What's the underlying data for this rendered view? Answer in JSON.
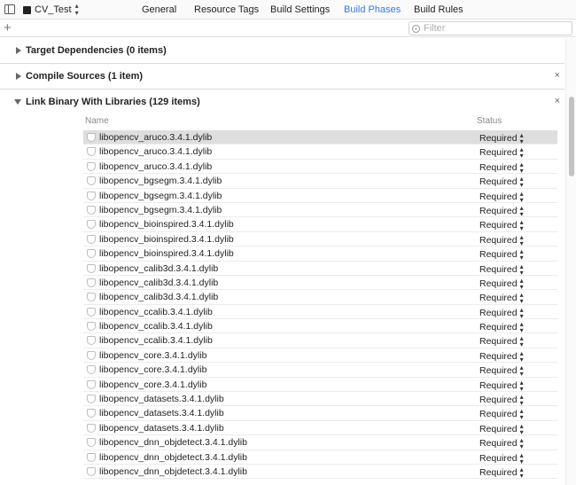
{
  "toolbar": {
    "target_name": "CV_Test",
    "tabs": [
      {
        "label": "General",
        "active": false
      },
      {
        "label": "Resource Tags",
        "active": false
      },
      {
        "label": "Build Settings",
        "active": false
      },
      {
        "label": "Build Phases",
        "active": true
      },
      {
        "label": "Build Rules",
        "active": false
      }
    ]
  },
  "filter": {
    "add_symbol": "+",
    "placeholder": "Filter"
  },
  "phases": {
    "target_dependencies": "Target Dependencies (0 items)",
    "compile_sources": "Compile Sources (1 item)",
    "link_binary": "Link Binary With Libraries (129 items)"
  },
  "close_symbol": "×",
  "columns": {
    "name": "Name",
    "status": "Status"
  },
  "libraries": [
    {
      "name": "libopencv_aruco.3.4.1.dylib",
      "status": "Required",
      "selected": true
    },
    {
      "name": "libopencv_aruco.3.4.1.dylib",
      "status": "Required"
    },
    {
      "name": "libopencv_aruco.3.4.1.dylib",
      "status": "Required"
    },
    {
      "name": "libopencv_bgsegm.3.4.1.dylib",
      "status": "Required"
    },
    {
      "name": "libopencv_bgsegm.3.4.1.dylib",
      "status": "Required"
    },
    {
      "name": "libopencv_bgsegm.3.4.1.dylib",
      "status": "Required"
    },
    {
      "name": "libopencv_bioinspired.3.4.1.dylib",
      "status": "Required"
    },
    {
      "name": "libopencv_bioinspired.3.4.1.dylib",
      "status": "Required"
    },
    {
      "name": "libopencv_bioinspired.3.4.1.dylib",
      "status": "Required"
    },
    {
      "name": "libopencv_calib3d.3.4.1.dylib",
      "status": "Required"
    },
    {
      "name": "libopencv_calib3d.3.4.1.dylib",
      "status": "Required"
    },
    {
      "name": "libopencv_calib3d.3.4.1.dylib",
      "status": "Required"
    },
    {
      "name": "libopencv_ccalib.3.4.1.dylib",
      "status": "Required"
    },
    {
      "name": "libopencv_ccalib.3.4.1.dylib",
      "status": "Required"
    },
    {
      "name": "libopencv_ccalib.3.4.1.dylib",
      "status": "Required"
    },
    {
      "name": "libopencv_core.3.4.1.dylib",
      "status": "Required"
    },
    {
      "name": "libopencv_core.3.4.1.dylib",
      "status": "Required"
    },
    {
      "name": "libopencv_core.3.4.1.dylib",
      "status": "Required"
    },
    {
      "name": "libopencv_datasets.3.4.1.dylib",
      "status": "Required"
    },
    {
      "name": "libopencv_datasets.3.4.1.dylib",
      "status": "Required"
    },
    {
      "name": "libopencv_datasets.3.4.1.dylib",
      "status": "Required"
    },
    {
      "name": "libopencv_dnn_objdetect.3.4.1.dylib",
      "status": "Required"
    },
    {
      "name": "libopencv_dnn_objdetect.3.4.1.dylib",
      "status": "Required"
    },
    {
      "name": "libopencv_dnn_objdetect.3.4.1.dylib",
      "status": "Required"
    }
  ]
}
